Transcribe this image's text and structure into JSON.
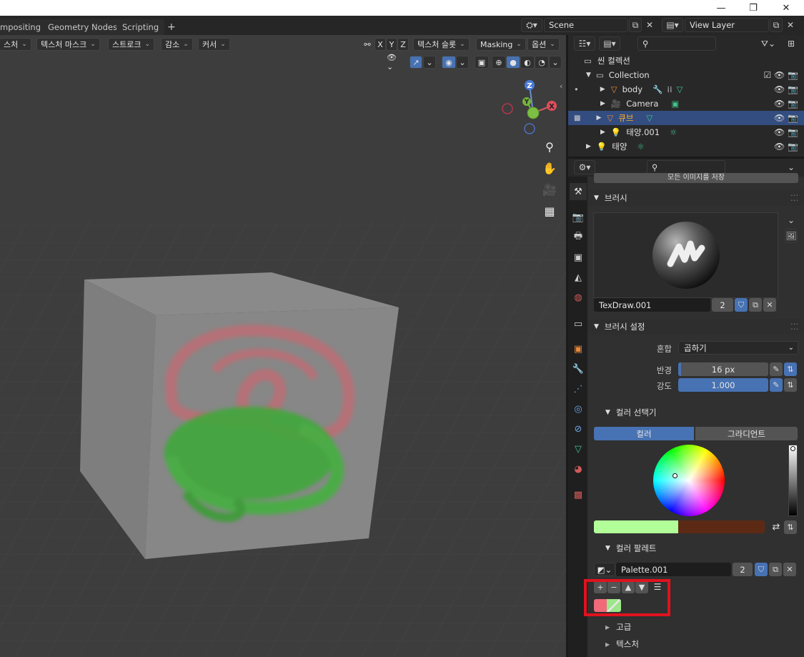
{
  "window": {
    "minimize_icon": "minimize-icon",
    "maximize_icon": "restore-icon",
    "close_icon": "close-icon"
  },
  "tabs": {
    "compositing": "mpositing",
    "geometry_nodes": "Geometry Nodes",
    "scripting": "Scripting",
    "add": "+"
  },
  "scene": {
    "name": "Scene",
    "view_layer": "View Layer"
  },
  "viewport_header": {
    "texture": "스처",
    "texture_mask": "텍스처 마스크",
    "stroke": "스트로크",
    "falloff": "감소",
    "cursor": "커서",
    "x": "X",
    "y": "Y",
    "z": "Z",
    "texture_slots": "텍스처 슬롯",
    "masking": "Masking",
    "options": "옵션"
  },
  "gizmo": {
    "z": "Z",
    "y": "Y",
    "x": "X"
  },
  "outliner": {
    "scene_collection": "씬 컬렉션",
    "collection": "Collection",
    "items": [
      {
        "name": "body"
      },
      {
        "name": "Camera"
      },
      {
        "name": "큐브"
      },
      {
        "name": "태양.001"
      },
      {
        "name": "태양"
      }
    ]
  },
  "properties": {
    "partial_button": "모든 이미지를 저장",
    "brush_panel": "브러시",
    "brush_name": "TexDraw.001",
    "brush_users": "2",
    "brush_settings_panel": "브러시 설정",
    "blend_label": "혼합",
    "blend_value": "곱하기",
    "radius_label": "반경",
    "radius_value": "16 px",
    "strength_label": "강도",
    "strength_value": "1.000",
    "color_picker_panel": "컬러 선택기",
    "color_tab": "컬러",
    "gradient_tab": "그라디언트",
    "palette_panel": "컬러 팔레트",
    "palette_name": "Palette.001",
    "palette_users": "2",
    "advanced_panel": "고급",
    "texture_panel": "텍스처"
  },
  "colors": {
    "accent_blue": "#4772b3",
    "primary_color": "#b2ff99",
    "secondary_color": "#5c2a14",
    "palette_swatch_1": "#f06a7a",
    "palette_swatch_2": "#9ee68a",
    "highlight_box": "#e0121e"
  }
}
